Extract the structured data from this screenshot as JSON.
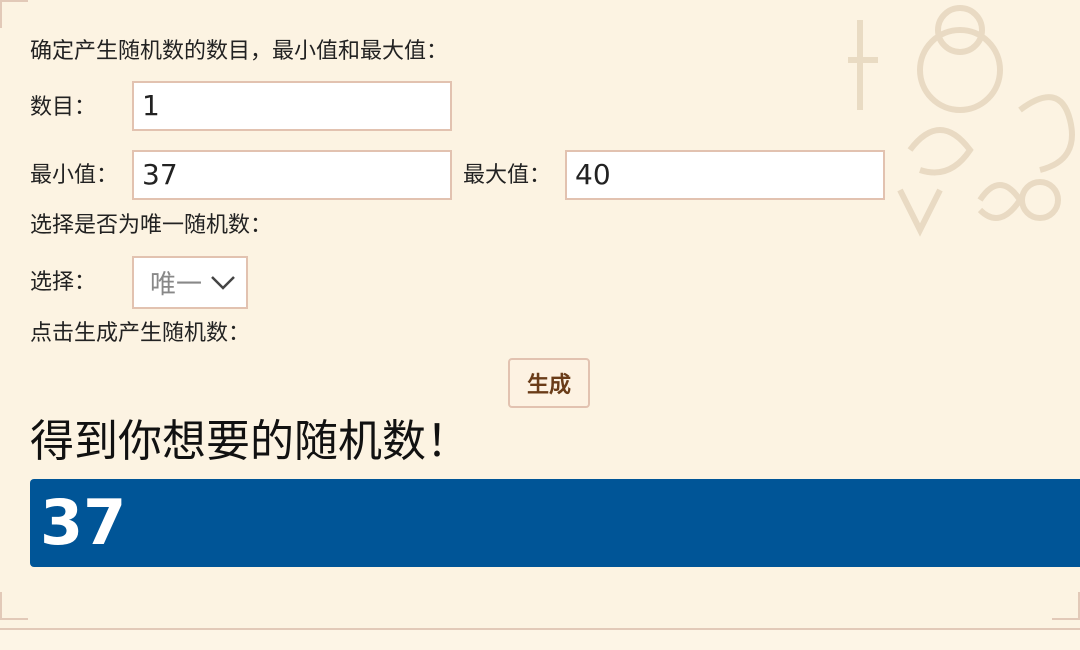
{
  "intro_label": "确定产生随机数的数目，最小值和最大值：",
  "count": {
    "label": "数目：",
    "value": "1"
  },
  "min": {
    "label": "最小值：",
    "value": "37"
  },
  "max": {
    "label": "最大值：",
    "value": "40"
  },
  "unique_prompt": "选择是否为唯一随机数：",
  "select": {
    "label": "选择：",
    "value": "唯一"
  },
  "generate_prompt": "点击生成产生随机数：",
  "generate_button": "生成",
  "result_heading": "得到你想要的随机数！",
  "result_value": "37",
  "colors": {
    "result_bg": "#005597",
    "border": "#e2c2b0",
    "button_text": "#6a3c18",
    "panel_bg": "#fcf3e2"
  }
}
